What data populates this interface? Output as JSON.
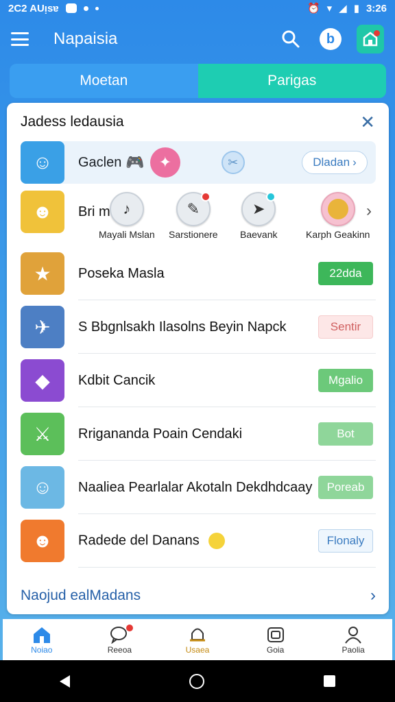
{
  "status_bar": {
    "left_text": "2C2 AUᴉsɐ",
    "time": "3:26"
  },
  "app": {
    "title": "Napaisia",
    "profile_letter": "b"
  },
  "tabs": [
    {
      "label": "Moetan"
    },
    {
      "label": "Parigas"
    }
  ],
  "card": {
    "title": "Jadess ledausia",
    "featured": {
      "name": "Gaclen",
      "button_label": "Dladan"
    },
    "shortcut_row": {
      "name": "Bri ma",
      "items": [
        {
          "label": "Mayali Mslan",
          "icon": "music-note-icon"
        },
        {
          "label": "Sarstionere",
          "icon": "wrench-icon"
        },
        {
          "label": "Baevank",
          "icon": "navigation-icon"
        },
        {
          "label": "Karph Geakinn",
          "icon": "coin-icon"
        }
      ]
    },
    "items": [
      {
        "name": "Poseka Masla",
        "button": "22dda",
        "style": "b-green",
        "thumb_color": "#e0a23a",
        "glyph": "★"
      },
      {
        "name": "S Bbgnlsakh Ilasolns Beyin Napck",
        "button": "Sentir",
        "style": "b-pink",
        "thumb_color": "#4d7fc4",
        "glyph": "✈"
      },
      {
        "name": "Kdbit Cancik",
        "button": "Mgalio",
        "style": "b-lgreen",
        "thumb_color": "#8b4bd1",
        "glyph": "◆"
      },
      {
        "name": "Rrigananda Poain Cendaki",
        "button": "Bot",
        "style": "b-llgreen",
        "thumb_color": "#5cbf5a",
        "glyph": "⚔"
      },
      {
        "name": "Naaliea Pearlalar Akotaln Dekdhdcaay",
        "button": "Poreab",
        "style": "b-llgreen",
        "thumb_color": "#6cb8e4",
        "glyph": "☺"
      },
      {
        "name": "Radede del Danans",
        "button": "Flonaly",
        "style": "b-outline",
        "thumb_color": "#f07a2e",
        "glyph": "☻"
      }
    ],
    "footer_link": "Naojud ealMadans"
  },
  "bottom_nav": [
    {
      "label": "Noiao",
      "icon": "home-icon"
    },
    {
      "label": "Reeoa",
      "icon": "chat-icon"
    },
    {
      "label": "Usaea",
      "icon": "bell-icon"
    },
    {
      "label": "Goia",
      "icon": "camera-icon"
    },
    {
      "label": "Paolia",
      "icon": "person-icon"
    }
  ],
  "colors": {
    "primary": "#2d8ae8",
    "accent": "#1ecdb2",
    "green": "#3db75a"
  }
}
